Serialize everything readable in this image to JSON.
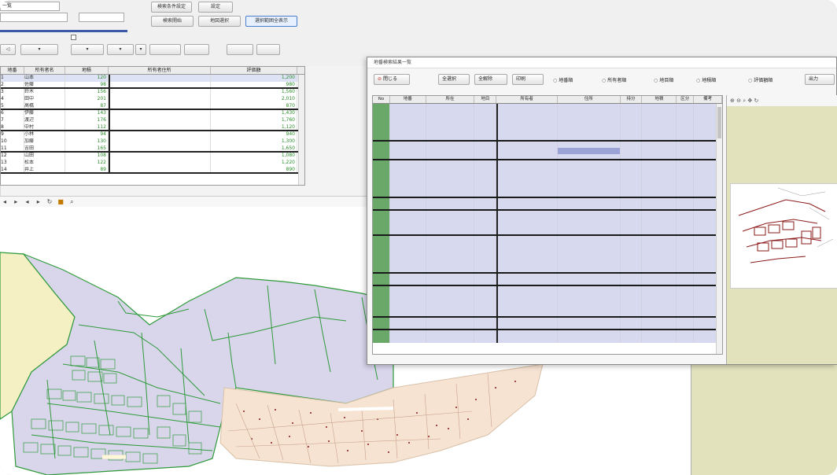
{
  "main_window": {
    "tab_label": "一覧",
    "controls": {
      "btn_top1": "検索条件設定",
      "btn_top2": "設定",
      "btn_mid1": "検索開始",
      "btn_mid2": "地図選択",
      "btn_mid3": "選択範囲全表示"
    },
    "grid_headers": [
      "地番",
      "所有者名",
      "地積",
      "所有者住所",
      "評価額"
    ],
    "grid_rows": [
      {
        "c1": "1",
        "c2": "山本",
        "c3": "120",
        "c4": "",
        "c5": "1,200",
        "thick": false
      },
      {
        "c1": "2",
        "c2": "佐藤",
        "c3": "98",
        "c4": "",
        "c5": "980",
        "thick": true
      },
      {
        "c1": "3",
        "c2": "鈴木",
        "c3": "156",
        "c4": "",
        "c5": "1,560",
        "thick": false
      },
      {
        "c1": "4",
        "c2": "田中",
        "c3": "201",
        "c4": "",
        "c5": "2,010",
        "thick": false
      },
      {
        "c1": "5",
        "c2": "高橋",
        "c3": "87",
        "c4": "",
        "c5": "870",
        "thick": true
      },
      {
        "c1": "6",
        "c2": "伊藤",
        "c3": "143",
        "c4": "",
        "c5": "1,430",
        "thick": false
      },
      {
        "c1": "7",
        "c2": "渡辺",
        "c3": "176",
        "c4": "",
        "c5": "1,760",
        "thick": false
      },
      {
        "c1": "8",
        "c2": "中村",
        "c3": "112",
        "c4": "",
        "c5": "1,120",
        "thick": true
      },
      {
        "c1": "9",
        "c2": "小林",
        "c3": "94",
        "c4": "",
        "c5": "940",
        "thick": false
      },
      {
        "c1": "10",
        "c2": "加藤",
        "c3": "130",
        "c4": "",
        "c5": "1,300",
        "thick": false
      },
      {
        "c1": "11",
        "c2": "吉田",
        "c3": "165",
        "c4": "",
        "c5": "1,650",
        "thick": true
      },
      {
        "c1": "12",
        "c2": "山田",
        "c3": "108",
        "c4": "",
        "c5": "1,080",
        "thick": false
      },
      {
        "c1": "13",
        "c2": "松本",
        "c3": "122",
        "c4": "",
        "c5": "1,220",
        "thick": false
      },
      {
        "c1": "14",
        "c2": "井上",
        "c3": "89",
        "c4": "",
        "c5": "890",
        "thick": true
      }
    ]
  },
  "dialog": {
    "title": "地番検索結果一覧",
    "buttons": {
      "close": "閉じる",
      "b1": "全選択",
      "b2": "全解除",
      "b3": "印刷"
    },
    "radios": [
      "地番順",
      "所有者順",
      "地目順",
      "地積順",
      "評価額順"
    ],
    "btn_right": "出力",
    "headers": [
      "No",
      "地番",
      "所在",
      "地目",
      "所有者",
      "住所",
      "持分",
      "地積",
      "区分",
      "備考"
    ],
    "row_count": 38
  },
  "colors": {
    "residential": "#d9d6ec",
    "commercial": "#f7e3d2",
    "agricultural": "#f5efc4",
    "parcel_line": "#2e9a3a",
    "highlight": "#8b1a1a"
  }
}
